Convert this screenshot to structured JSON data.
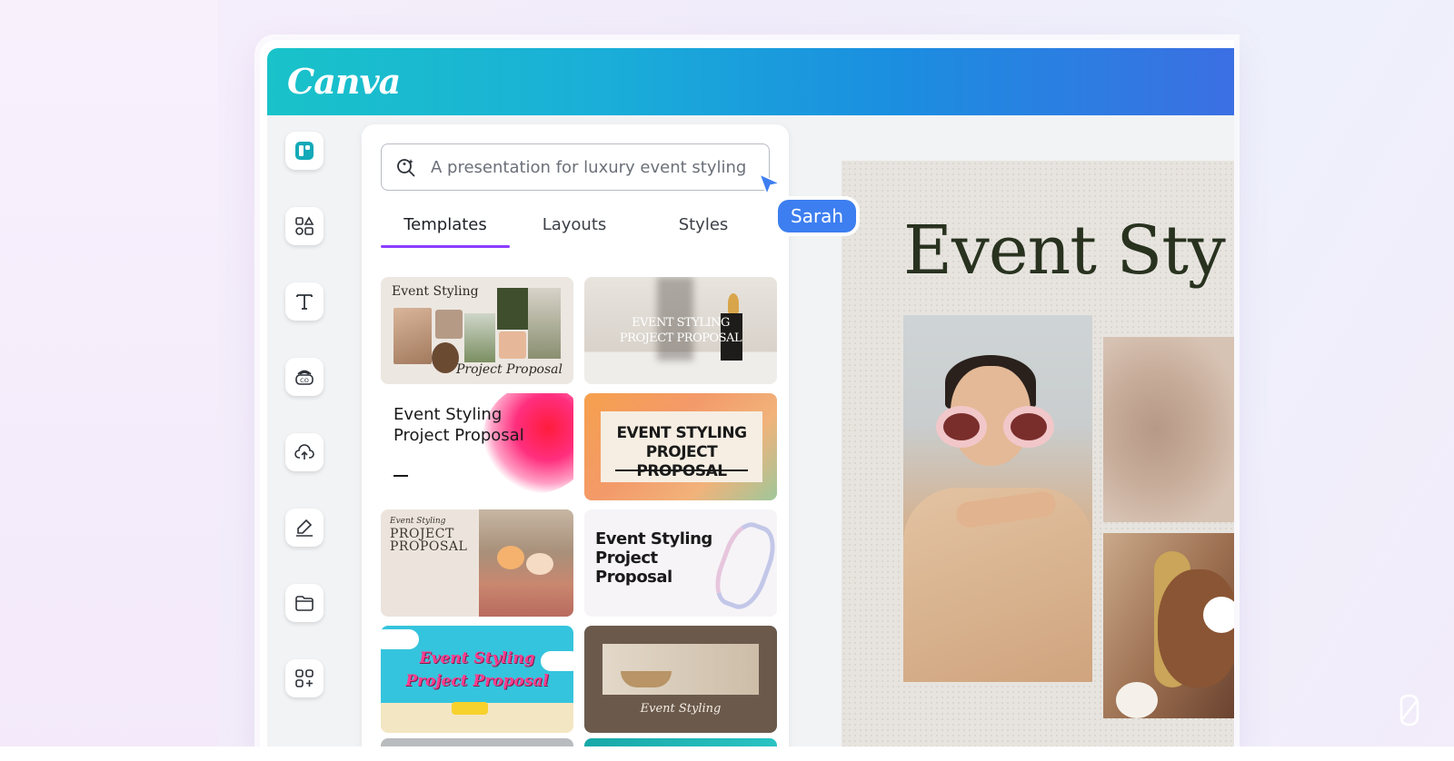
{
  "app": {
    "logo_text": "Canva",
    "brand_color": "#00c4cc",
    "accent_color": "#8b3dff",
    "collab_color": "#3d7ef0"
  },
  "sidebar": {
    "items": [
      {
        "icon": "design-icon",
        "active": true
      },
      {
        "icon": "elements-icon"
      },
      {
        "icon": "text-icon"
      },
      {
        "icon": "brand-icon"
      },
      {
        "icon": "upload-cloud-icon"
      },
      {
        "icon": "draw-icon"
      },
      {
        "icon": "folder-icon"
      },
      {
        "icon": "apps-icon"
      }
    ]
  },
  "search": {
    "icon": "magic-search-icon",
    "value": "A presentation for luxury event styling"
  },
  "tabs": [
    {
      "label": "Templates",
      "active": true
    },
    {
      "label": "Layouts"
    },
    {
      "label": "Styles"
    }
  ],
  "templates": [
    {
      "line1": "Event Styling",
      "line2": "Project Proposal"
    },
    {
      "line1": "EVENT STYLING",
      "line2": "PROJECT PROPOSAL"
    },
    {
      "line1": "Event Styling",
      "line2": "Project Proposal"
    },
    {
      "line1": "EVENT STYLING",
      "line2": "PROJECT PROPOSAL"
    },
    {
      "small": "Event Styling",
      "line1": "PROJECT",
      "line2": "PROPOSAL"
    },
    {
      "line1": "Event Styling",
      "line2": "Project",
      "line3": "Proposal"
    },
    {
      "line1": "Event Styling",
      "line2": "Project Proposal"
    },
    {
      "line1": "Event Styling"
    }
  ],
  "collaborator": {
    "name": "Sarah"
  },
  "canvas": {
    "title": "Event Sty"
  }
}
